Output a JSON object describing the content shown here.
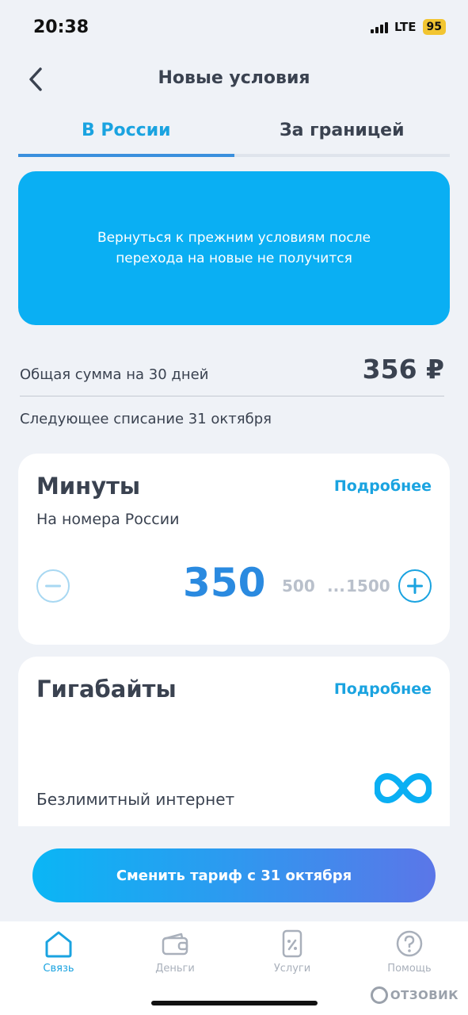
{
  "status_bar": {
    "time": "20:38",
    "network": "LTE",
    "battery": "95"
  },
  "header": {
    "title": "Новые условия"
  },
  "tabs": [
    {
      "label": "В России",
      "active": true
    },
    {
      "label": "За границей",
      "active": false
    }
  ],
  "notice": {
    "text": "Вернуться к прежним условиям после перехода на новые не получится"
  },
  "summary": {
    "total_label": "Общая сумма на 30 дней",
    "total_value": "356 ₽",
    "next_charge": "Следующее списание 31 октября"
  },
  "minutes_card": {
    "title": "Минуты",
    "details_link": "Подробнее",
    "subtitle": "На номера России",
    "selected": "350",
    "options": [
      "500",
      "...",
      "1500"
    ]
  },
  "gigabytes_card": {
    "title": "Гигабайты",
    "details_link": "Подробнее",
    "label": "Безлимитный интернет"
  },
  "cta": {
    "label": "Сменить тариф с 31 октября"
  },
  "tabbar": [
    {
      "label": "Связь",
      "icon": "home-icon",
      "active": true
    },
    {
      "label": "Деньги",
      "icon": "wallet-icon",
      "active": false
    },
    {
      "label": "Услуги",
      "icon": "services-icon",
      "active": false
    },
    {
      "label": "Помощь",
      "icon": "help-icon",
      "active": false
    }
  ],
  "watermark": "ОТЗОВИК",
  "colors": {
    "accent": "#1aa3e0",
    "notice_bg": "#0aaff3",
    "background": "#eff2f7",
    "text": "#3a4250"
  }
}
